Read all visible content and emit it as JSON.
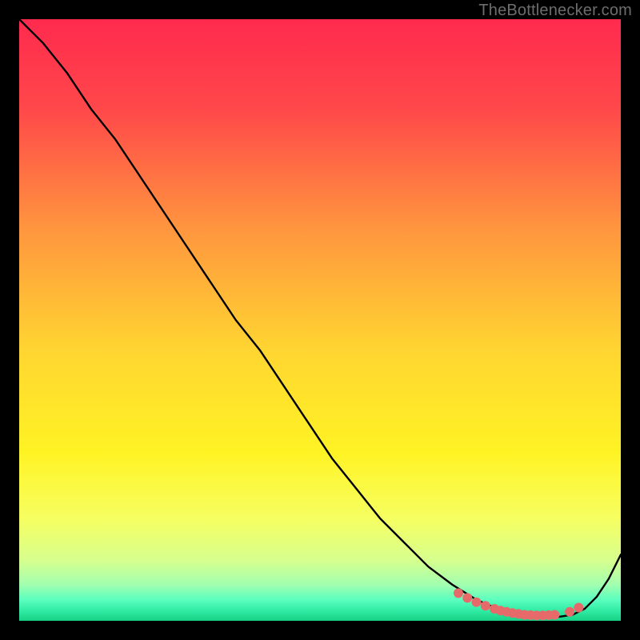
{
  "watermark": "TheBottlenecker.com",
  "chart_data": {
    "type": "line",
    "title": "",
    "xlabel": "",
    "ylabel": "",
    "xlim": [
      0,
      100
    ],
    "ylim": [
      0,
      100
    ],
    "grid": false,
    "series": [
      {
        "name": "curve",
        "x": [
          0,
          4,
          8,
          12,
          16,
          20,
          24,
          28,
          32,
          36,
          40,
          44,
          48,
          52,
          56,
          60,
          64,
          68,
          72,
          76,
          80,
          82,
          84,
          86,
          88,
          90,
          92,
          94,
          96,
          98,
          100
        ],
        "y": [
          100,
          96,
          91,
          85,
          80,
          74,
          68,
          62,
          56,
          50,
          45,
          39,
          33,
          27,
          22,
          17,
          13,
          9,
          6,
          3.5,
          1.8,
          1.2,
          0.9,
          0.7,
          0.6,
          0.7,
          1.0,
          2.0,
          4.0,
          7.0,
          11
        ]
      }
    ],
    "markers": {
      "name": "dots",
      "x": [
        73,
        74.5,
        76,
        77.5,
        79,
        80,
        81,
        82,
        83,
        84,
        85,
        86,
        87,
        88,
        89,
        91.5,
        93
      ],
      "y": [
        4.6,
        3.8,
        3.1,
        2.5,
        2.0,
        1.7,
        1.5,
        1.3,
        1.15,
        1.0,
        0.95,
        0.9,
        0.9,
        0.95,
        1.0,
        1.5,
        2.2
      ]
    },
    "gradient_stops": [
      {
        "offset": 0.0,
        "color": "#ff2a4e"
      },
      {
        "offset": 0.15,
        "color": "#ff484a"
      },
      {
        "offset": 0.35,
        "color": "#ff963e"
      },
      {
        "offset": 0.55,
        "color": "#ffd531"
      },
      {
        "offset": 0.72,
        "color": "#fff324"
      },
      {
        "offset": 0.83,
        "color": "#f6ff61"
      },
      {
        "offset": 0.9,
        "color": "#d6ff8e"
      },
      {
        "offset": 0.94,
        "color": "#a2ffb0"
      },
      {
        "offset": 0.965,
        "color": "#5bffbf"
      },
      {
        "offset": 0.985,
        "color": "#2de9a0"
      },
      {
        "offset": 1.0,
        "color": "#18d085"
      }
    ],
    "curve_color": "#000000",
    "marker_color": "#e76a6a"
  }
}
